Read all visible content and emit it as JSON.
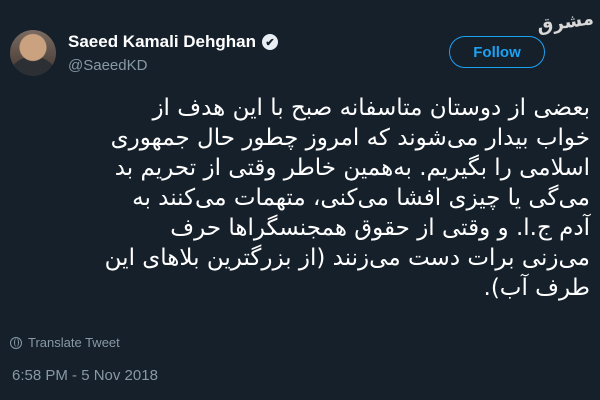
{
  "tweet": {
    "author_name": "Saeed Kamali Dehghan",
    "verified_icon": "✔",
    "handle": "@SaeedKD",
    "follow_label": "Follow",
    "watermark": "مشرق",
    "lines": [
      "بعضی از دوستان متاسفانه صبح با این هدف از",
      "خواب بیدار می‌شوند که امروز چطور حال جمهوری",
      "اسلامی را بگیریم. به‌همین خاطر وقتی از تحریم بد",
      "می‌گی یا چیزی افشا می‌کنی، متهمات می‌کنند به",
      "آدم ج.ا. و وقتی از حقوق همجنسگراها حرف",
      "می‌زنی برات دست می‌زنند (از بزرگترین بلاهای این",
      "طرف آب)."
    ],
    "translate_label": "Translate Tweet",
    "timestamp": "6:58 PM - 5 Nov 2018"
  }
}
